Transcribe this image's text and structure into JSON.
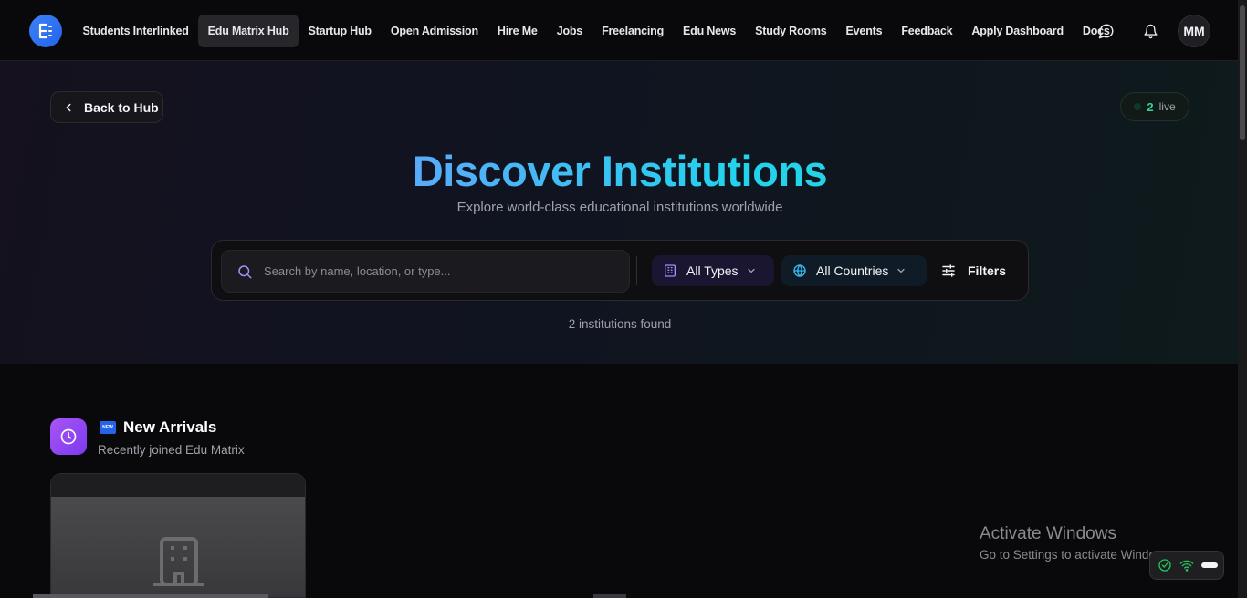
{
  "nav": {
    "items": [
      {
        "label": "Students Interlinked"
      },
      {
        "label": "Edu Matrix Hub"
      },
      {
        "label": "Startup Hub"
      },
      {
        "label": "Open Admission"
      },
      {
        "label": "Hire Me"
      },
      {
        "label": "Jobs"
      },
      {
        "label": "Freelancing"
      },
      {
        "label": "Edu News"
      },
      {
        "label": "Study Rooms"
      },
      {
        "label": "Events"
      },
      {
        "label": "Feedback"
      },
      {
        "label": "Apply Dashboard"
      },
      {
        "label": "Docs"
      }
    ],
    "active_item": "Edu Matrix Hub",
    "avatar_initials": "MM",
    "icons": [
      "message-circle-icon",
      "bell-icon"
    ]
  },
  "hero": {
    "back_label": "Back to Hub",
    "live_count": "2",
    "live_label": "live",
    "title": "Discover Institutions",
    "subtitle": "Explore world-class educational institutions worldwide",
    "search_placeholder": "Search by name, location, or type...",
    "type_select": "All Types",
    "country_select": "All Countries",
    "filters_label": "Filters",
    "results_text": "2 institutions found"
  },
  "section": {
    "badge": "NEW",
    "title": "New Arrivals",
    "subtitle": "Recently joined Edu Matrix"
  },
  "watermark": {
    "title": "Activate Windows",
    "subtitle": "Go to Settings to activate Windows."
  },
  "colors": {
    "background": "#09090b",
    "accent_blue": "#3b82f6",
    "accent_purple": "#a855f7",
    "live_green": "#34d399"
  }
}
